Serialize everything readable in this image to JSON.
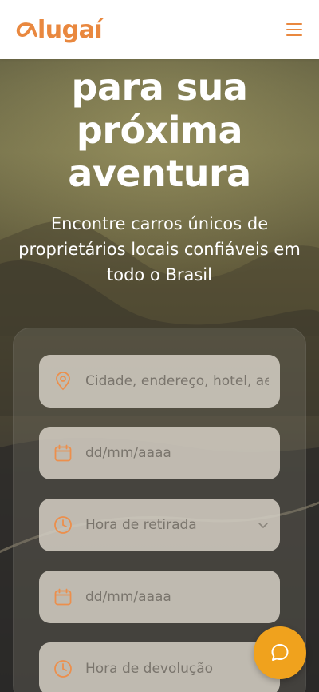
{
  "brand": {
    "name": "lugaí",
    "color": "#e9883f"
  },
  "header": {
    "menu_icon": "hamburger-icon"
  },
  "hero": {
    "headline_lines": [
      "para sua",
      "próxima",
      "aventura"
    ],
    "subtitle": "Encontre carros únicos de proprietários locais confiáveis em todo o Brasil"
  },
  "search_form": {
    "location_placeholder": "Cidade, endereço, hotel, aeroporto",
    "pickup_date_placeholder": "dd/mm/aaaa",
    "pickup_time_label": "Hora de retirada",
    "return_date_placeholder": "dd/mm/aaaa",
    "return_time_label": "Hora de devolução"
  },
  "chat": {
    "icon": "chat-bubble-icon",
    "color": "#f0a21d"
  },
  "colors": {
    "accent": "#e9883f",
    "field_bg": "#d4cec4"
  }
}
